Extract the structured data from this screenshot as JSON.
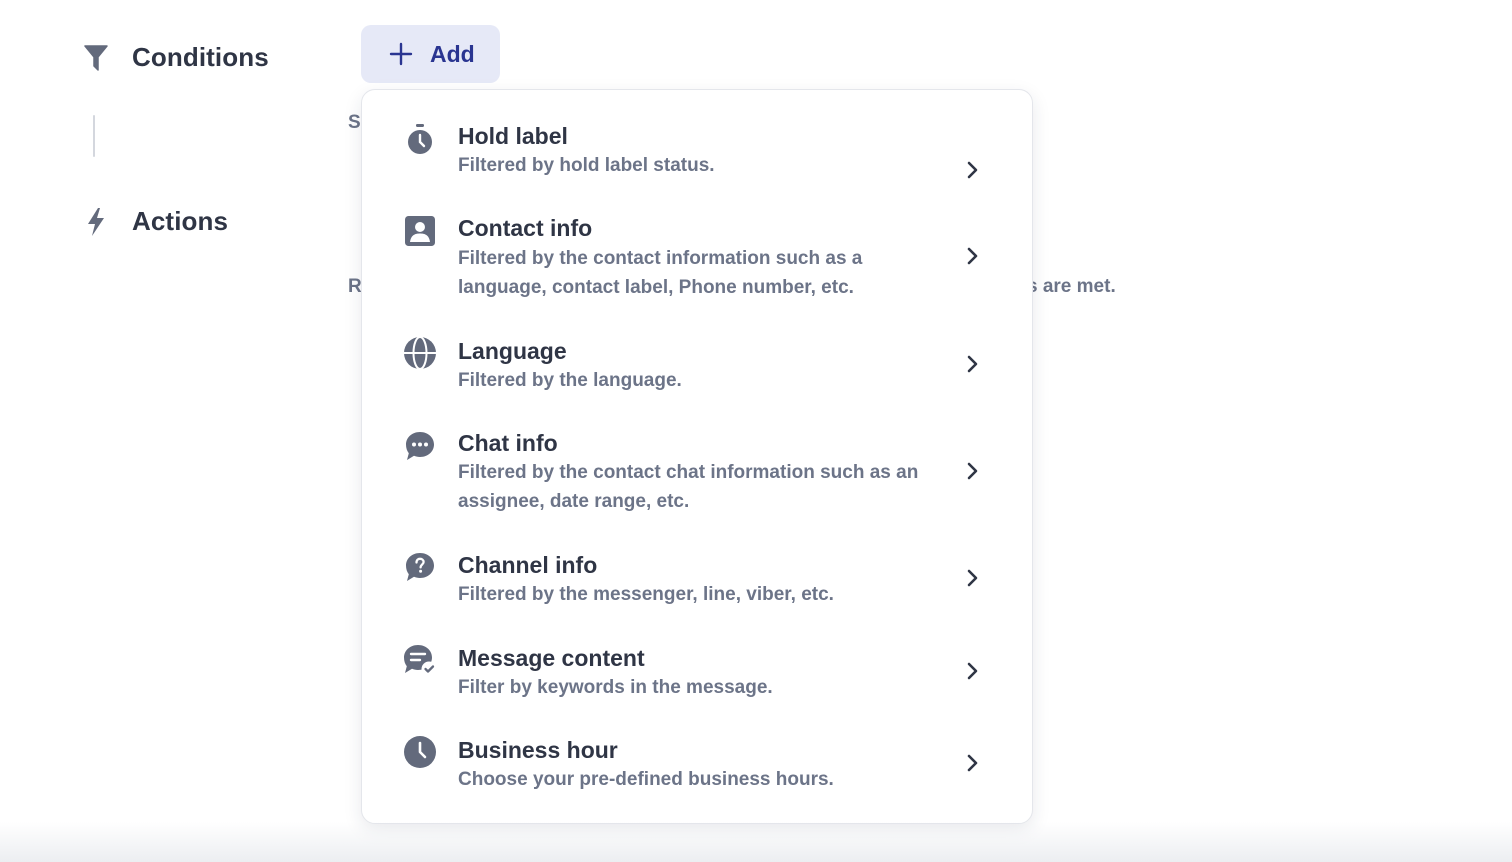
{
  "sections": {
    "conditions": {
      "title": "Conditions",
      "icon": "filter-icon"
    },
    "actions": {
      "title": "Actions",
      "icon": "lightning-icon"
    }
  },
  "hints": {
    "conditions_partial": "S",
    "actions_partial": "R",
    "actions_tail": "s are met."
  },
  "add_button": {
    "label": "Add",
    "icon": "plus-icon"
  },
  "menu": {
    "items": [
      {
        "title": "Hold label",
        "description": "Filtered by hold label status.",
        "icon": "stopwatch-icon"
      },
      {
        "title": "Contact info",
        "description": "Filtered by the contact information such as a language, contact label, Phone number, etc.",
        "icon": "contact-card-icon"
      },
      {
        "title": "Language",
        "description": "Filtered by the language.",
        "icon": "globe-icon"
      },
      {
        "title": "Chat info",
        "description": "Filtered by the contact chat information such as an assignee, date range, etc.",
        "icon": "chat-bubble-icon"
      },
      {
        "title": "Channel info",
        "description": "Filtered by the messenger, line, viber, etc.",
        "icon": "question-bubble-icon"
      },
      {
        "title": "Message content",
        "description": "Filter by keywords in the message.",
        "icon": "message-check-icon"
      },
      {
        "title": "Business hour",
        "description": "Choose your pre-defined business hours.",
        "icon": "clock-icon"
      }
    ]
  },
  "colors": {
    "text_primary": "#2f3545",
    "text_secondary": "#6c7488",
    "icon": "#636a7c",
    "add_button_bg": "#e6e9f7",
    "add_button_text": "#2a3591"
  }
}
